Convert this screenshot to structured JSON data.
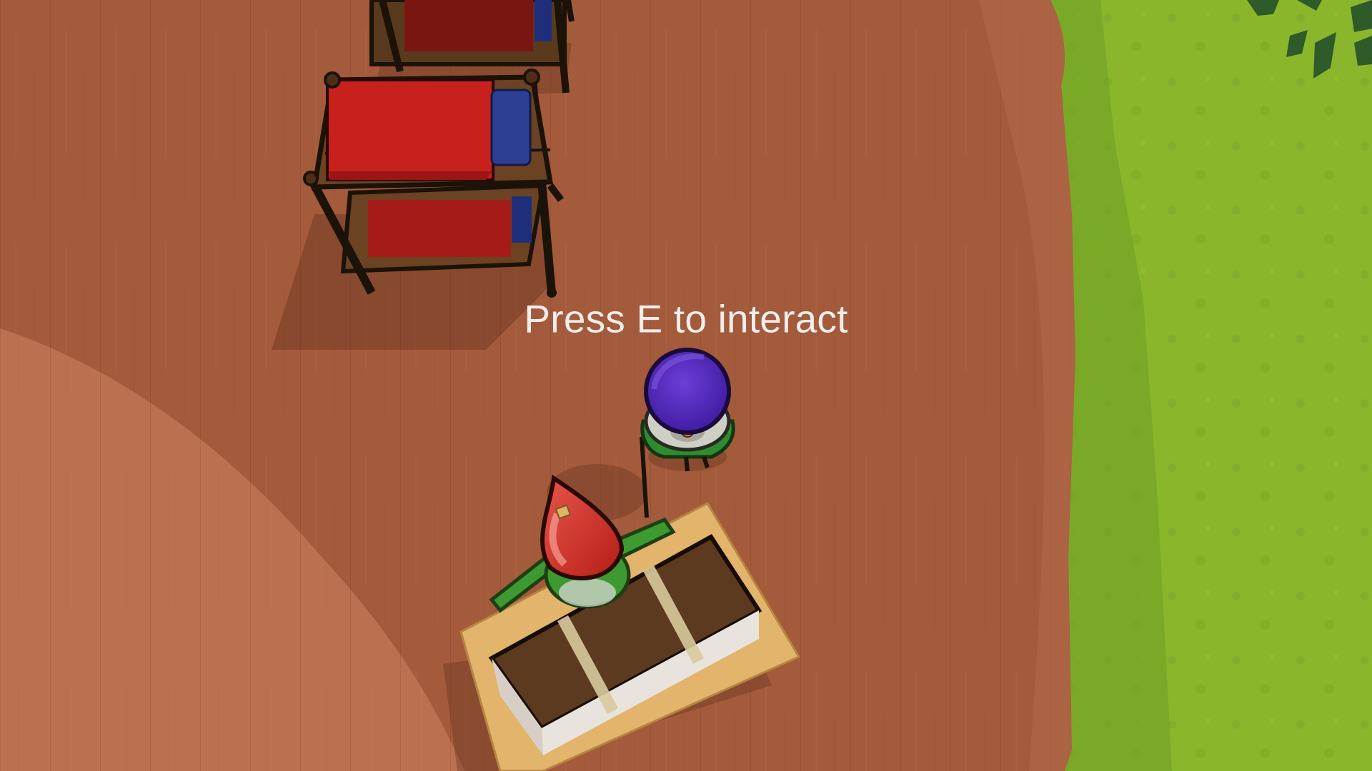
{
  "hud": {
    "interact_prompt": "Press E to interact"
  },
  "colors": {
    "grass": "#8ab62c",
    "floor": "#a35b3c",
    "bed_blanket": "#c8201c",
    "bed_pillow": "#2d3e95",
    "player_hat": "#c3261e",
    "npc_hat": "#4a22b5",
    "gnome_shirt": "#2e8c2e",
    "prompt_text": "#f0eeec"
  },
  "scene": {
    "objects": [
      "bunk-bed",
      "bunk-bed",
      "player-gnome",
      "npc-gnome",
      "wooden-crate"
    ]
  }
}
